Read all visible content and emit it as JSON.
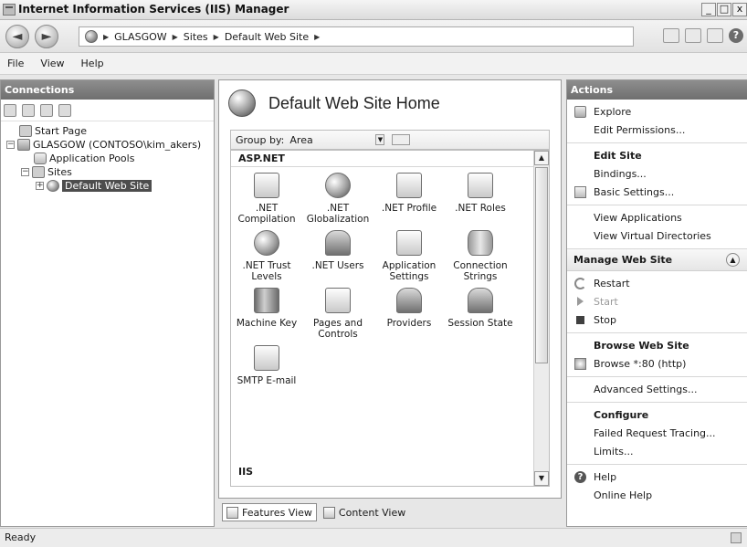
{
  "window": {
    "title": "Internet Information Services (IIS) Manager",
    "minimize": "_",
    "maximize": "□",
    "close": "x"
  },
  "address": {
    "back": "◄",
    "forward": "►",
    "crumbs": [
      "GLASGOW",
      "Sites",
      "Default Web Site"
    ],
    "separator": "▶",
    "help": "?"
  },
  "menu": [
    "File",
    "View",
    "Help"
  ],
  "connections": {
    "header": "Connections",
    "tree": [
      {
        "label": "Start Page",
        "icon": "start-page-icon"
      },
      {
        "label": "GLASGOW (CONTOSO\\kim_akers)",
        "expander": "−",
        "icon": "server-icon"
      },
      {
        "label": "Application Pools",
        "icon": "app-pool-icon"
      },
      {
        "label": "Sites",
        "expander": "−",
        "icon": "sites-folder-icon"
      },
      {
        "label": "Default Web Site",
        "expander": "+",
        "icon": "website-globe-icon",
        "selected": true
      }
    ]
  },
  "main": {
    "title": "Default Web Site Home",
    "group_by_label": "Group by:",
    "group_by_value": "Area",
    "section_aspnet": "ASP.NET",
    "section_iis": "IIS",
    "features": [
      {
        "label": ".NET Compilation",
        "icon": "dotnet-compilation-icon"
      },
      {
        "label": ".NET Globalization",
        "icon": "dotnet-globalization-icon"
      },
      {
        "label": ".NET Profile",
        "icon": "dotnet-profile-icon"
      },
      {
        "label": ".NET Roles",
        "icon": "dotnet-roles-icon"
      },
      {
        "label": ".NET Trust Levels",
        "icon": "dotnet-trust-levels-icon"
      },
      {
        "label": ".NET Users",
        "icon": "dotnet-users-icon"
      },
      {
        "label": "Application Settings",
        "icon": "application-settings-icon"
      },
      {
        "label": "Connection Strings",
        "icon": "connection-strings-icon"
      },
      {
        "label": "Machine Key",
        "icon": "machine-key-icon"
      },
      {
        "label": "Pages and Controls",
        "icon": "pages-controls-icon"
      },
      {
        "label": "Providers",
        "icon": "providers-icon"
      },
      {
        "label": "Session State",
        "icon": "session-state-icon"
      },
      {
        "label": "SMTP E-mail",
        "icon": "smtp-email-icon"
      }
    ],
    "view_tabs": {
      "features": "Features View",
      "content": "Content View"
    }
  },
  "actions": {
    "header": "Actions",
    "explore": "Explore",
    "edit_permissions": "Edit Permissions...",
    "edit_site_title": "Edit Site",
    "bindings": "Bindings...",
    "basic_settings": "Basic Settings...",
    "view_applications": "View Applications",
    "view_virtual_directories": "View Virtual Directories",
    "manage_title": "Manage Web Site",
    "restart": "Restart",
    "start": "Start",
    "stop": "Stop",
    "browse_title": "Browse Web Site",
    "browse_80": "Browse *:80 (http)",
    "advanced_settings": "Advanced Settings...",
    "configure_title": "Configure",
    "failed_request_tracing": "Failed Request Tracing...",
    "limits": "Limits...",
    "help": "Help",
    "online_help": "Online Help"
  },
  "status": {
    "text": "Ready"
  }
}
